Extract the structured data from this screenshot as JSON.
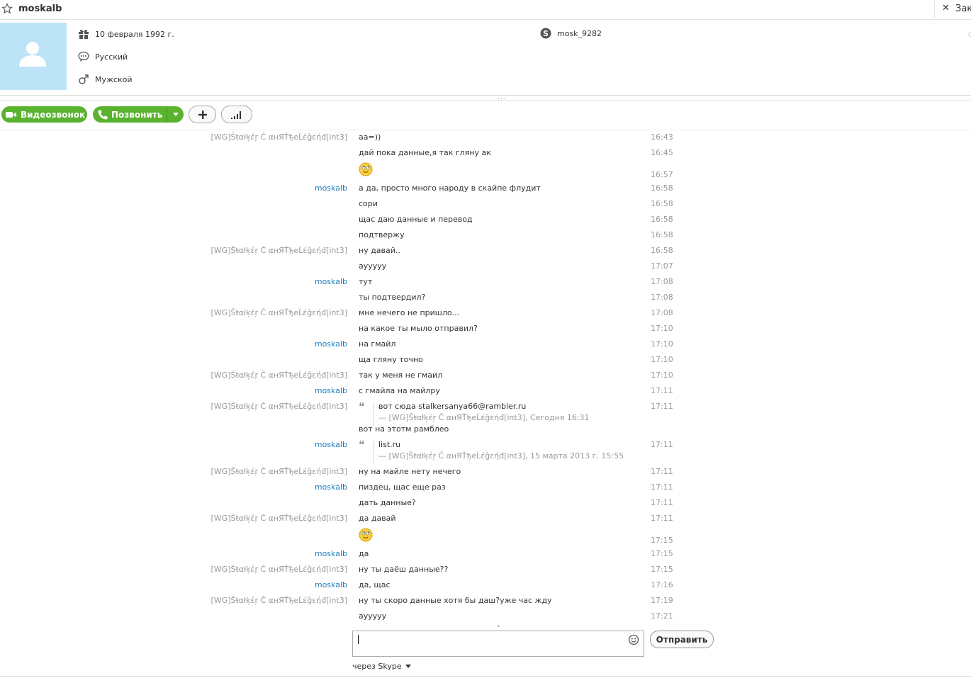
{
  "header": {
    "contact_name": "moskalb",
    "close_label": "Зак",
    "close_icon": "✕"
  },
  "profile": {
    "birthday": "10 февраля 1992 г.",
    "language": "Русский",
    "gender": "Мужской",
    "skype_name": "mosk_9282",
    "more_dot": "○"
  },
  "grip": "...",
  "toolbar": {
    "video_label": "Видеозвонок",
    "call_label": "Позвонить"
  },
  "chat": {
    "messages": [
      {
        "sender": "[WG]Šŧαłķέŗ Č αнЯŤђеĹέĝεήđ[int3]",
        "type": "other",
        "text": "aa=))",
        "time": "16:43"
      },
      {
        "sender": "",
        "type": "other",
        "text": "дай пока данные,я так гляну ак",
        "time": "16:45"
      },
      {
        "sender": "",
        "type": "other",
        "text": "",
        "emoji": "smile",
        "time": "16:57"
      },
      {
        "sender": "moskalb",
        "type": "me",
        "text": "а да, просто много народу в скайпе флудит",
        "time": "16:58"
      },
      {
        "sender": "",
        "type": "me",
        "text": "сори",
        "time": "16:58"
      },
      {
        "sender": "",
        "type": "me",
        "text": "щас даю данные и перевод",
        "time": "16:58"
      },
      {
        "sender": "",
        "type": "me",
        "text": "подтвержу",
        "time": "16:58"
      },
      {
        "sender": "[WG]Šŧαłķέŗ Č αнЯŤђеĹέĝεήđ[int3]",
        "type": "other",
        "text": "ну давай..",
        "time": "16:58"
      },
      {
        "sender": "",
        "type": "other",
        "text": "ауyyyy",
        "time": "17:07"
      },
      {
        "sender": "moskalb",
        "type": "me",
        "text": "тут",
        "time": "17:08"
      },
      {
        "sender": "",
        "type": "me",
        "text": "ты подтвердил?",
        "time": "17:08"
      },
      {
        "sender": "[WG]Šŧαłķέŗ Č αнЯŤђеĹέĝεήđ[int3]",
        "type": "other",
        "text": "мне нечего не пришло...",
        "time": "17:08"
      },
      {
        "sender": "",
        "type": "other",
        "text": "на какое ты мыло отправил?",
        "time": "17:10"
      },
      {
        "sender": "moskalb",
        "type": "me",
        "text": "на гмайл",
        "time": "17:10"
      },
      {
        "sender": "",
        "type": "me",
        "text": "ща гляну точно",
        "time": "17:10"
      },
      {
        "sender": "[WG]Šŧαłķέŗ Č αнЯŤђеĹέĝεήđ[int3]",
        "type": "other",
        "text": "так у меня не гмаил",
        "time": "17:10"
      },
      {
        "sender": "moskalb",
        "type": "me",
        "text": "с гмайла на майлру",
        "time": "17:11"
      },
      {
        "sender": "[WG]Šŧαłķέŗ Č αнЯŤђеĹέĝεήđ[int3]",
        "type": "other",
        "quote_text": "вот сюда stalkersanya66@rambler.ru",
        "quote_source": "— [WG]Šŧαłķέŗ Č αнЯŤђеĹέĝεήđ[int3], Сегодня 16:31",
        "time": "17:11"
      },
      {
        "sender": "",
        "type": "other",
        "text": "вот на этотм рамблео",
        "time": ""
      },
      {
        "sender": "moskalb",
        "type": "me",
        "quote_text": "list.ru",
        "quote_source": "— [WG]Šŧαłķέŗ Č αнЯŤђеĹέĝεήđ[int3], 15 марта 2013 г. 15:55",
        "time": "17:11"
      },
      {
        "sender": "[WG]Šŧαłķέŗ Č αнЯŤђеĹέĝεήđ[int3]",
        "type": "other",
        "text": "ну на майле нету нечего",
        "time": "17:11"
      },
      {
        "sender": "moskalb",
        "type": "me",
        "text": "пиздец, щас еще раз",
        "time": "17:11"
      },
      {
        "sender": "",
        "type": "me",
        "text": "дать данные?",
        "time": "17:11"
      },
      {
        "sender": "[WG]Šŧαłķέŗ Č αнЯŤђеĹέĝεήđ[int3]",
        "type": "other",
        "text": "да давай",
        "time": "17:11"
      },
      {
        "sender": "",
        "type": "other",
        "text": "",
        "emoji": "smile",
        "time": "17:15"
      },
      {
        "sender": "moskalb",
        "type": "me",
        "text": "да",
        "time": "17:15"
      },
      {
        "sender": "[WG]Šŧαłķέŗ Č αнЯŤђеĹέĝεήđ[int3]",
        "type": "other",
        "text": "ну ты даёш данные??",
        "time": "17:15"
      },
      {
        "sender": "moskalb",
        "type": "me",
        "text": "да, щас",
        "time": "17:16"
      },
      {
        "sender": "[WG]Šŧαłķέŗ Č αнЯŤђеĹέĝεήđ[int3]",
        "type": "other",
        "text": "ну ты скоро данные хотя бы даш?уже час жду",
        "time": "17:19"
      },
      {
        "sender": "",
        "type": "other",
        "text": "ауyyyy",
        "time": "17:21"
      }
    ]
  },
  "compose": {
    "input_value": "",
    "send_label": "Отправить",
    "via_label": "через Skype"
  },
  "colors": {
    "green": "#5ab32e",
    "me_blue": "#1e7ec0",
    "muted_gray": "#999999",
    "avatar_bg": "#bde3f7"
  }
}
